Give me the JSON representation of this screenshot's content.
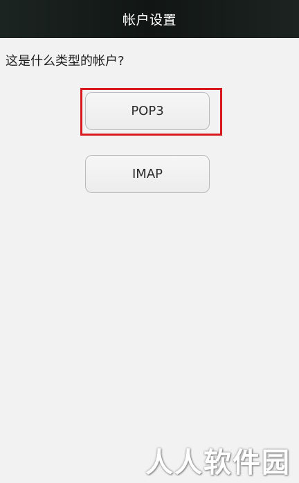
{
  "header": {
    "title": "帐户设置"
  },
  "main": {
    "question": "这是什么类型的帐户?",
    "options": [
      {
        "label": "POP3",
        "highlighted": true
      },
      {
        "label": "IMAP",
        "highlighted": false
      }
    ]
  },
  "annotation": {
    "highlight_color": "#d7191f"
  },
  "watermark": {
    "text": "人人软件园"
  }
}
